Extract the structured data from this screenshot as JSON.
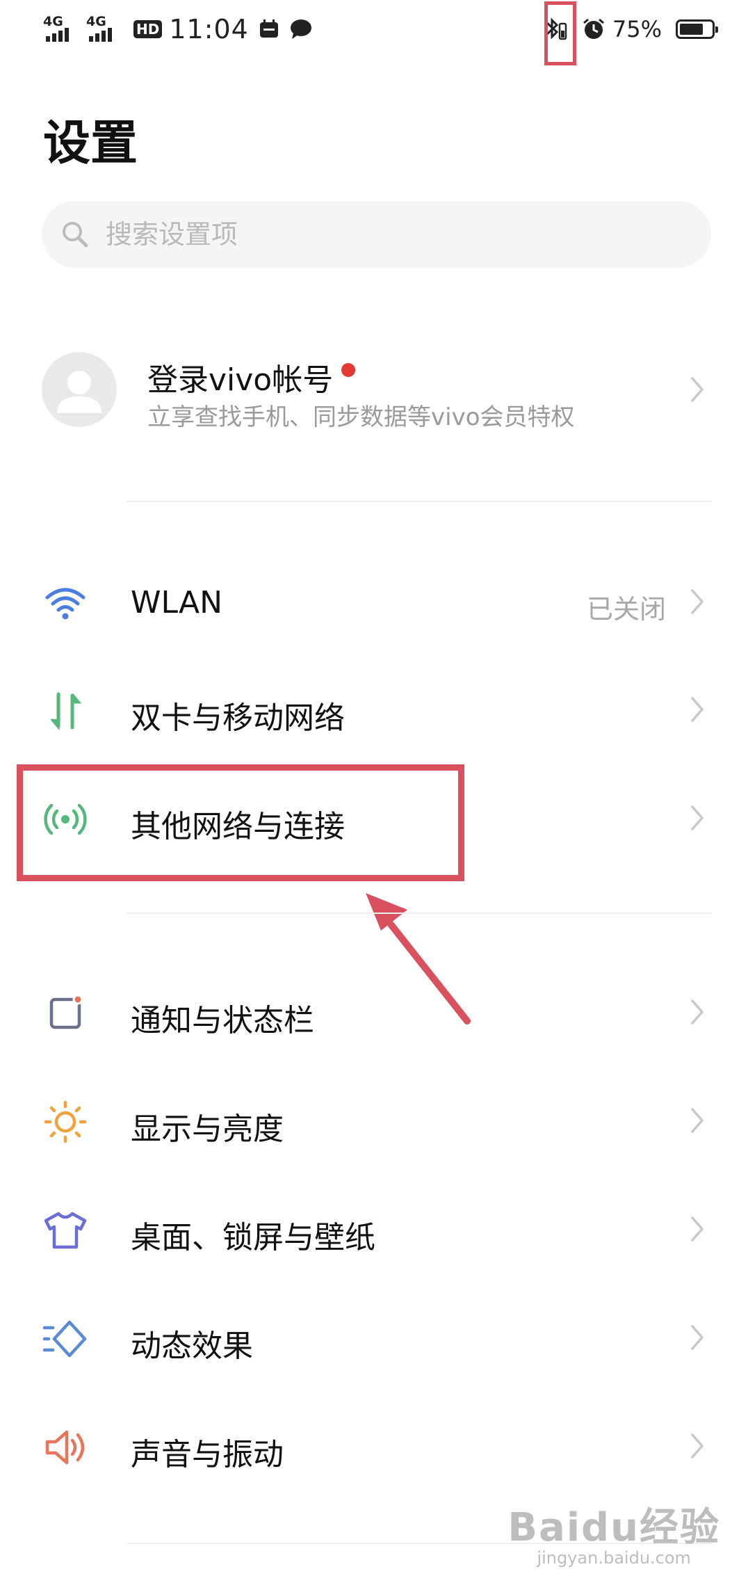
{
  "status_bar": {
    "network_1": "4G",
    "network_2": "4G",
    "hd_badge": "HD",
    "time": "11:04",
    "battery_percent": "75%",
    "battery_level": 0.75
  },
  "page": {
    "title": "设置"
  },
  "search": {
    "placeholder": "搜索设置项"
  },
  "account": {
    "title": "登录vivo帐号",
    "subtitle": "立享查找手机、同步数据等vivo会员特权",
    "has_notification_dot": true
  },
  "settings_items": [
    {
      "id": "wlan",
      "label": "WLAN",
      "value": "已关闭",
      "icon": "wifi-icon"
    },
    {
      "id": "dual-sim",
      "label": "双卡与移动网络",
      "value": "",
      "icon": "mobile-data-icon"
    },
    {
      "id": "other-networks",
      "label": "其他网络与连接",
      "value": "",
      "icon": "connection-icon"
    },
    {
      "id": "notifications",
      "label": "通知与状态栏",
      "value": "",
      "icon": "notification-icon"
    },
    {
      "id": "display",
      "label": "显示与亮度",
      "value": "",
      "icon": "sun-icon"
    },
    {
      "id": "desktop",
      "label": "桌面、锁屏与壁纸",
      "value": "",
      "icon": "shirt-icon"
    },
    {
      "id": "animations",
      "label": "动态效果",
      "value": "",
      "icon": "motion-icon"
    },
    {
      "id": "sound",
      "label": "声音与振动",
      "value": "",
      "icon": "speaker-icon"
    }
  ],
  "watermark": {
    "main": "Baidu经验",
    "sub": "jingyan.baidu.com"
  },
  "colors": {
    "highlight": "#d9505e",
    "wifi": "#4a7fe0",
    "mobile": "#55b87a",
    "connection": "#55b87a",
    "notification": "#6b6f8a",
    "display": "#f2a23a",
    "desktop": "#6a6fd6",
    "animations": "#5a8ad6",
    "sound": "#e8745a"
  }
}
